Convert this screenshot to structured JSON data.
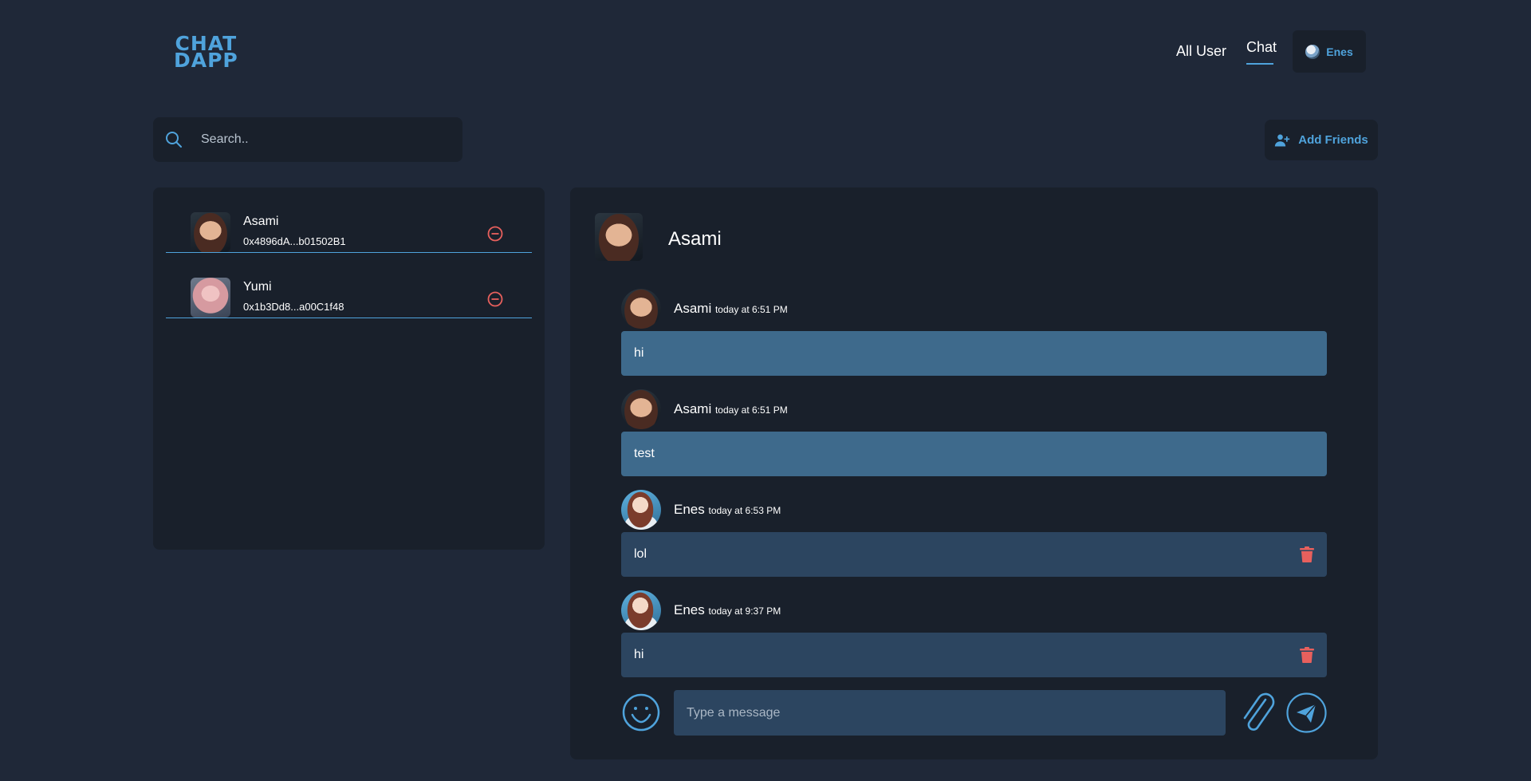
{
  "app": {
    "logo_line1": "CHAT",
    "logo_line2": "DAPP"
  },
  "nav": {
    "all_user": "All User",
    "chat": "Chat",
    "user_name": "Enes"
  },
  "search": {
    "placeholder": "Search.."
  },
  "add_friends": {
    "label": "Add Friends"
  },
  "friends": [
    {
      "name": "Asami",
      "address": "0x4896dA...b01502B1"
    },
    {
      "name": "Yumi",
      "address": "0x1b3Dd8...a00C1f48"
    }
  ],
  "chat": {
    "partner_name": "Asami",
    "messages": [
      {
        "sender": "Asami",
        "time": "today at 6:51 PM",
        "text": "hi",
        "direction": "in"
      },
      {
        "sender": "Asami",
        "time": "today at 6:51 PM",
        "text": "test",
        "direction": "in"
      },
      {
        "sender": "Enes",
        "time": "today at 6:53 PM",
        "text": "lol",
        "direction": "out"
      },
      {
        "sender": "Enes",
        "time": "today at 9:37 PM",
        "text": "hi",
        "direction": "out"
      }
    ],
    "input_placeholder": "Type a message"
  },
  "colors": {
    "background": "#1f2838",
    "panel": "#19202b",
    "accent": "#4fa3dc",
    "incoming_bubble": "#3e6a8c",
    "outgoing_bubble": "#2c4560",
    "danger": "#e8605d"
  }
}
